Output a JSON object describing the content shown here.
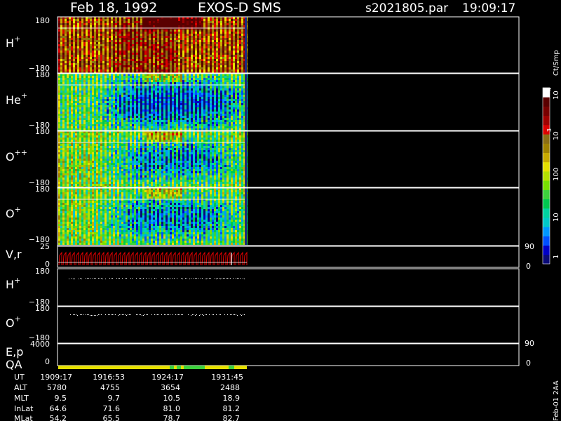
{
  "header": {
    "date": "Feb 18, 1992",
    "mission": "EXOS-D SMS",
    "file": "s2021805.par",
    "time": "19:09:17"
  },
  "colorbar": {
    "label": "Ct/Smp",
    "ticks": [
      "1",
      "10",
      "100",
      "10",
      "10"
    ],
    "exponents": [
      "",
      "",
      "",
      "3",
      "4"
    ],
    "colors": [
      "#0a0a78",
      "#0000c8",
      "#0050ff",
      "#0096ff",
      "#00c8c8",
      "#00d2a0",
      "#00c850",
      "#3cd23c",
      "#78e000",
      "#b4e000",
      "#e6e000",
      "#c8aa00",
      "#a08200",
      "#8c6e14",
      "#dc0000",
      "#a00000",
      "#780000",
      "#5a0000",
      "#ffffff"
    ]
  },
  "chart_data": {
    "type": "heatmap",
    "panels": [
      {
        "id": "H",
        "label": "H",
        "sup": "+",
        "ytop": "180",
        "ybot": "−180"
      },
      {
        "id": "He",
        "label": "He",
        "sup": "+",
        "ytop": "180",
        "ybot": "−180"
      },
      {
        "id": "Opp",
        "label": "O",
        "sup": "++",
        "ytop": "180",
        "ybot": "−180"
      },
      {
        "id": "Op",
        "label": "O",
        "sup": "+",
        "ytop": "180",
        "ybot": "−180"
      }
    ],
    "vr": {
      "label": "V,r",
      "ytop": "25",
      "ybot": "0",
      "rtop": "90",
      "rbot": "0"
    },
    "pa": [
      {
        "label": "H",
        "sup": "+",
        "ytop": "180",
        "ybot": "−180"
      },
      {
        "label": "O",
        "sup": "+",
        "ytop": "180",
        "ybot": "−180"
      }
    ],
    "ep": {
      "label": "E,p",
      "ytop": "4000",
      "ybot": "0",
      "rtop": "90",
      "rbot": "0"
    },
    "qa": {
      "label": "QA"
    },
    "overlap_label": "−180"
  },
  "footer": {
    "rows": [
      {
        "name": "UT",
        "values": [
          "1909:17",
          "1916:53",
          "1924:17",
          "1931:45"
        ]
      },
      {
        "name": "ALT",
        "values": [
          "5780",
          "4755",
          "3654",
          "2488"
        ]
      },
      {
        "name": "MLT",
        "values": [
          "9.5",
          "9.7",
          "10.5",
          "18.9"
        ]
      },
      {
        "name": "InLat",
        "values": [
          "64.6",
          "71.6",
          "81.0",
          "81.2"
        ]
      },
      {
        "name": "MLat",
        "values": [
          "54.2",
          "65.5",
          "78.7",
          "82.7"
        ]
      }
    ],
    "vertical_note": "Feb-01 2AA"
  }
}
